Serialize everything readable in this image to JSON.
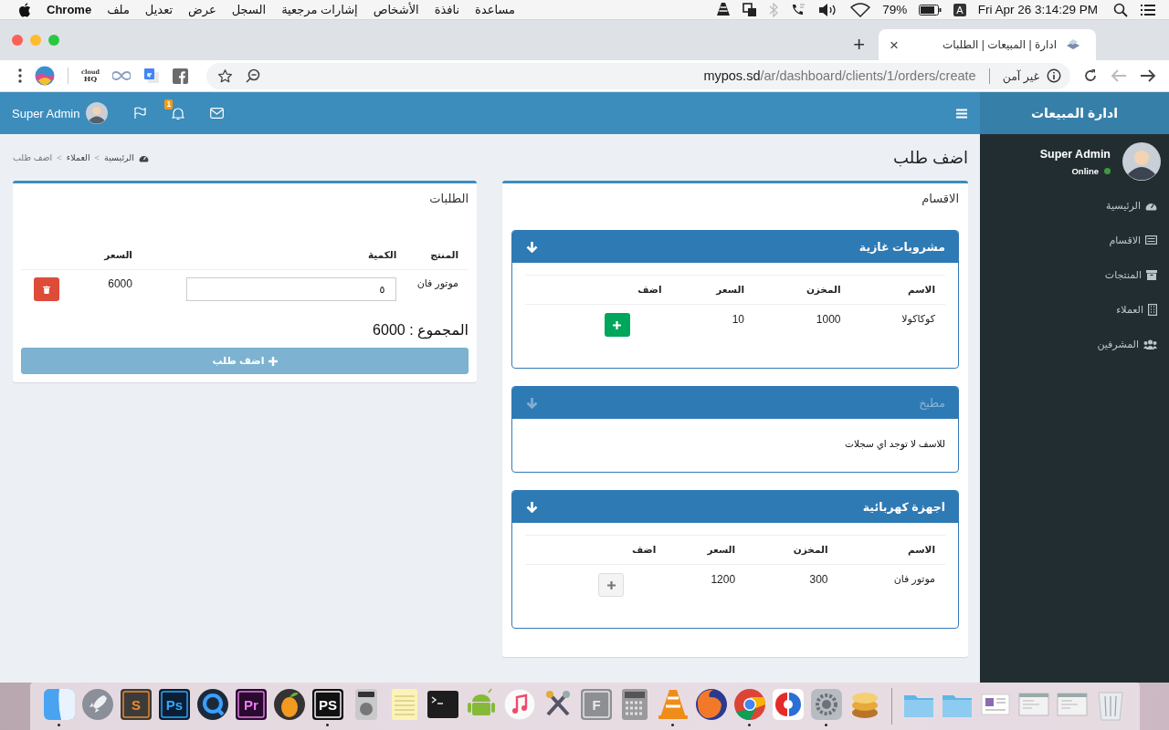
{
  "menubar": {
    "app": "Chrome",
    "menus": [
      "مساعدة",
      "نافذة",
      "الأشخاص",
      "إشارات مرجعية",
      "السجل",
      "عرض",
      "تعديل",
      "ملف"
    ],
    "battery": "79%",
    "input_source": "A",
    "clock": "Fri Apr 26  3:14:29 PM"
  },
  "browser": {
    "tab_title": "ادارة | المبيعات | الطلبات",
    "close_tab": "×",
    "new_tab": "+",
    "extension_label": [
      "cloud",
      "HQ"
    ],
    "security": "غير آمن",
    "url_host": "mypos.sd",
    "url_path": "/ar/dashboard/clients/1/orders/create",
    "back_disabled": true
  },
  "app": {
    "brand": "ادارة المبيعات",
    "topbar_user": "Super Admin",
    "notifications": "1",
    "sidebar_user": {
      "name": "Super Admin",
      "status": "Online",
      "online": true
    },
    "nav": [
      {
        "label": "الرئيسية",
        "kind": "dashboard"
      },
      {
        "label": "الاقسام",
        "kind": "list"
      },
      {
        "label": "المنتجات",
        "kind": "archive"
      },
      {
        "label": "العملاء",
        "kind": "building"
      },
      {
        "label": "المشرفين",
        "kind": "users"
      }
    ],
    "page_title": "اضف طلب",
    "breadcrumb": {
      "separator": ">",
      "items": [
        "الرئيسية",
        "العملاء",
        "اضف طلب"
      ]
    },
    "categories_panel": {
      "title": "الاقسام",
      "categories": [
        {
          "name": "مشروبات غازية",
          "muted": false,
          "columns": [
            "الاسم",
            "المخزن",
            "السعر",
            "اضف"
          ],
          "products": [
            {
              "name": "كوكاكولا",
              "stock": "1000",
              "price": "10",
              "added": false
            }
          ]
        },
        {
          "name": "مطبخ",
          "muted": true,
          "empty_text": "للاسف لا توجد اي سجلات"
        },
        {
          "name": "اجهزة كهربائية",
          "muted": false,
          "columns": [
            "الاسم",
            "المخزن",
            "السعر",
            "اضف"
          ],
          "products": [
            {
              "name": "موتور فان",
              "stock": "300",
              "price": "1200",
              "added": true
            }
          ]
        }
      ]
    },
    "orders_panel": {
      "title": "الطلبات",
      "columns": [
        "المنتج",
        "الكمية",
        "السعر"
      ],
      "items": [
        {
          "product": "موتور فان",
          "quantity": "٥",
          "price": "6000"
        }
      ],
      "total": "المجموع : 6000",
      "submit": "اضف طلب",
      "submit_disabled": true
    }
  },
  "dock": {
    "items": [
      {
        "kind": "trash",
        "running": false
      },
      {
        "kind": "window",
        "running": false
      },
      {
        "kind": "window",
        "running": false
      },
      {
        "kind": "document",
        "running": false
      },
      {
        "kind": "folder",
        "running": false
      },
      {
        "kind": "folder",
        "running": false
      },
      {
        "kind": "separator"
      },
      {
        "kind": "database",
        "running": false
      },
      {
        "kind": "settings",
        "running": true
      },
      {
        "kind": "swirl",
        "running": false
      },
      {
        "kind": "chrome",
        "running": true
      },
      {
        "kind": "firefox",
        "running": false
      },
      {
        "kind": "vlc",
        "running": true
      },
      {
        "kind": "calculator",
        "running": false
      },
      {
        "kind": "font",
        "label": "F",
        "running": false
      },
      {
        "kind": "tools",
        "running": false
      },
      {
        "kind": "music",
        "running": false
      },
      {
        "kind": "android",
        "running": false
      },
      {
        "kind": "terminal",
        "running": false
      },
      {
        "kind": "notes",
        "running": false
      },
      {
        "kind": "dvd",
        "running": false
      },
      {
        "kind": "phpstorm",
        "label": "PS",
        "running": true
      },
      {
        "kind": "fruit",
        "running": false
      },
      {
        "kind": "pr",
        "label": "Pr",
        "running": false
      },
      {
        "kind": "quicktime",
        "running": false
      },
      {
        "kind": "ps",
        "label": "Ps",
        "running": false
      },
      {
        "kind": "sublime",
        "label": "S",
        "running": false
      },
      {
        "kind": "rocket",
        "running": false
      },
      {
        "kind": "finder",
        "running": true
      }
    ]
  }
}
